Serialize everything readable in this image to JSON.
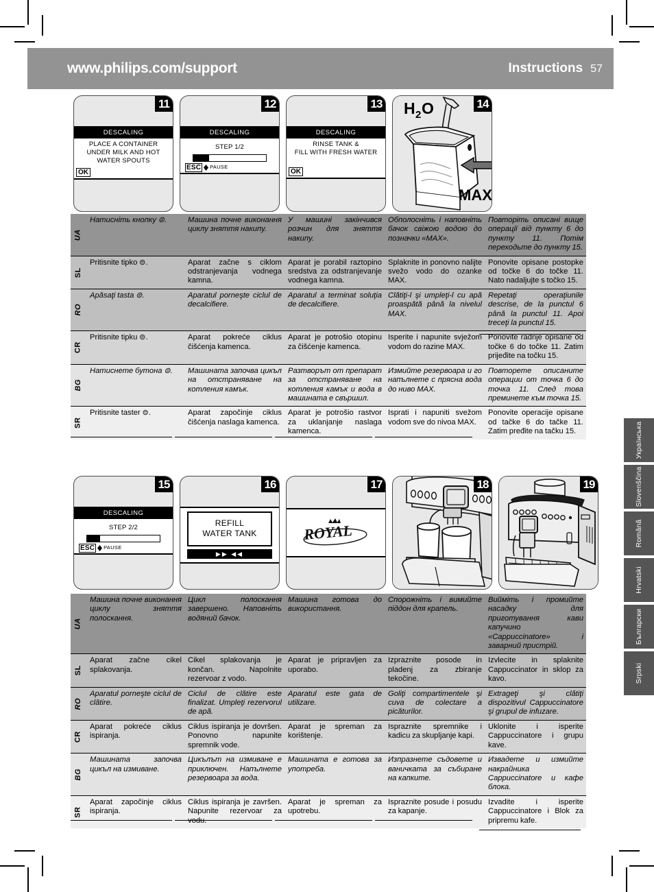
{
  "header": {
    "url": "www.philips.com/support",
    "title": "Instructions",
    "page": "57"
  },
  "panels_row1": [
    {
      "number": "11",
      "type": "lcd",
      "screen": {
        "title": "DESCALING",
        "lines": [
          "PLACE A CONTAINER",
          "UNDER MILK AND HOT",
          "WATER SPOUTS"
        ],
        "button": "OK"
      }
    },
    {
      "number": "12",
      "type": "lcd-progress",
      "screen": {
        "title": "DESCALING",
        "step": "STEP 1/2",
        "esc": "ESC",
        "pause": "PAUSE",
        "progress_percent": 22
      }
    },
    {
      "number": "13",
      "type": "lcd",
      "screen": {
        "title": "DESCALING",
        "lines": [
          "RINSE TANK &",
          "FILL WITH FRESH WATER"
        ],
        "button": "OK"
      }
    },
    {
      "number": "14",
      "type": "illustration-tank",
      "labels": {
        "water": "H",
        "water_sub": "2",
        "water_o": "O",
        "max": "MAX"
      }
    }
  ],
  "panels_row2": [
    {
      "number": "15",
      "type": "lcd-progress",
      "screen": {
        "title": "DESCALING",
        "step": "STEP 2/2",
        "esc": "ESC",
        "pause": "PAUSE",
        "progress_percent": 18
      }
    },
    {
      "number": "16",
      "type": "lcd-refill",
      "screen": {
        "lines": [
          "REFILL",
          "WATER TANK"
        ],
        "bar_glyphs": "▶▶ ◀◀"
      }
    },
    {
      "number": "17",
      "type": "lcd-logo",
      "screen": {
        "logo": "ROYAL"
      }
    },
    {
      "number": "18",
      "type": "illustration-machine-cups"
    },
    {
      "number": "19",
      "type": "illustration-machine"
    }
  ],
  "table1": {
    "languages": [
      "UA",
      "SL",
      "RO",
      "CR",
      "BG",
      "SR"
    ],
    "rows": [
      [
        "Натисніть кнопку ⊜.",
        "Машина почне виконання циклу зняття накипу.",
        "У машині закінчився розчин для зняття накипу.",
        "Обполосніть і наповніть бачок свіжою водою до позначки «MAX».",
        "Повторіть описані вище операції від пункту 6 до пункту 11. Потім переходьте до пункту 15."
      ],
      [
        "Pritisnite tipko ⊜.",
        "Aparat začne s ciklom odstranjevanja vodnega kamna.",
        "Aparat je porabil raztopino sredstva za odstranjevanje vodnega kamna.",
        "Splaknite in ponovno nalijte svežo vodo do ozanke MAX.",
        "Ponovite opisane postopke od točke 6 do točke 11. Nato nadaljujte s točko 15."
      ],
      [
        "Apăsaţi tasta ⊜.",
        "Aparatul porneşte ciclul de decalcifiere.",
        "Aparatul a terminat soluţia de decalcifiere.",
        "Clătiţi-l şi umpleţi-l cu apă proaspătă până la nivelul MAX.",
        "Repetaţi operaţiunile descrise, de la punctul 6 până la punctul 11. Apoi treceţi la punctul 15."
      ],
      [
        "Pritisnite tipku ⊜.",
        "Aparat pokreće ciklus čišćenja kamenca.",
        "Aparat je potrošio otopinu za čišćenje kamenca.",
        "Isperite i napunite svježom vodom do razine MAX.",
        "Ponovite radnje opisane od točke 6 do točke 11. Zatim prijeđite na točku 15."
      ],
      [
        "Натиснете бутона ⊜.",
        "Машината започва цикъл на отстраняване на котления камък.",
        "Разтворът от препарат за отстраняване на котления камък и вода в машината е свършил.",
        "Измийте резервоара и го напълнете с прясна вода до ниво MAX.",
        "Повторете описаните операции от точка 6 до точка 11. След това преминете към точка 15."
      ],
      [
        "Pritisnite taster ⊜.",
        "Aparat započinje ciklus čišćenja naslaga kamenca.",
        "Aparat je potrošio rastvor za uklanjanje naslaga kamenca.",
        "Isprati i napuniti svežom vodom sve do nivoa MAX.",
        "Ponovite operacije opisane od tačke 6 do tačke 11. Zatim pređite na tačku 15."
      ]
    ]
  },
  "table2": {
    "languages": [
      "UA",
      "SL",
      "RO",
      "CR",
      "BG",
      "SR"
    ],
    "rows": [
      [
        "Машина почне виконання циклу зняття полоскання.",
        "Цикл полоскання завершено. Наповніть водяний бачок.",
        "Машина готова до використання.",
        "Спорожніть і вимийте піддон для крапель.",
        "Вийміть і промийте насадку для приготування кави капучино «Cappuccinatore» і заварний пристрій."
      ],
      [
        "Aparat začne cikel splakovanja.",
        "Cikel splakovanja je končan. Napolnite rezervoar z vodo.",
        "Aparat je pripravljen za uporabo.",
        "Izpraznite posode in pladenj za zbiranje tekočine.",
        "Izvlecite in splaknite Cappuccinator in sklop za kavo."
      ],
      [
        "Aparatul porneşte ciclul de clătire.",
        "Ciclul de clătire este finalizat. Umpleţi rezervorul de apă.",
        "Aparatul este gata de utilizare.",
        "Goliţi compartimentele şi cuva de colectare a picăturilor.",
        "Extrageţi şi clătiţi dispozitivul Cappuccinatore şi grupul de infuzare."
      ],
      [
        "Aparat pokreće ciklus ispiranja.",
        "Ciklus ispiranja je dovršen. Ponovno napunite spremnik vode.",
        "Aparat je spreman za korištenje.",
        "Ispraznite spremnike i kadicu za skupljanje kapi.",
        "Uklonite i isperite Cappuccinatore i grupu kave."
      ],
      [
        "Машината започва цикъл на измиване.",
        "Цикълът на измиване е приключен. Напълнете резервоара за вода.",
        "Машината е готова за употреба.",
        "Изпразнете съдовете и ваничката за събиране на капките.",
        "Извадете и измийте накрайника Cappuccinatore и кафе блока."
      ],
      [
        "Aparat započinje ciklus ispiranja.",
        "Ciklus ispiranja je završen. Napunite rezervoar za vodu.",
        "Aparat je spreman za upotrebu.",
        "Ispraznite posude i posudu za kapanje.",
        "Izvadite i isperite Cappuccinatore i Blok za pripremu kafe."
      ]
    ]
  },
  "side_tabs": [
    "Українська",
    "Slovenščina",
    "Română",
    "Hrvatski",
    "Български",
    "Srpski"
  ],
  "colors": {
    "header_band": "#939393",
    "row0": "#949494",
    "row1": "#bfbfbf",
    "row2": "#bfbfbf",
    "row3": "#d4d4d4",
    "row4": "#e3e3e3",
    "row5": "#efefef",
    "side_tab": "#555555",
    "panel_bg": "#e8e8e8"
  }
}
